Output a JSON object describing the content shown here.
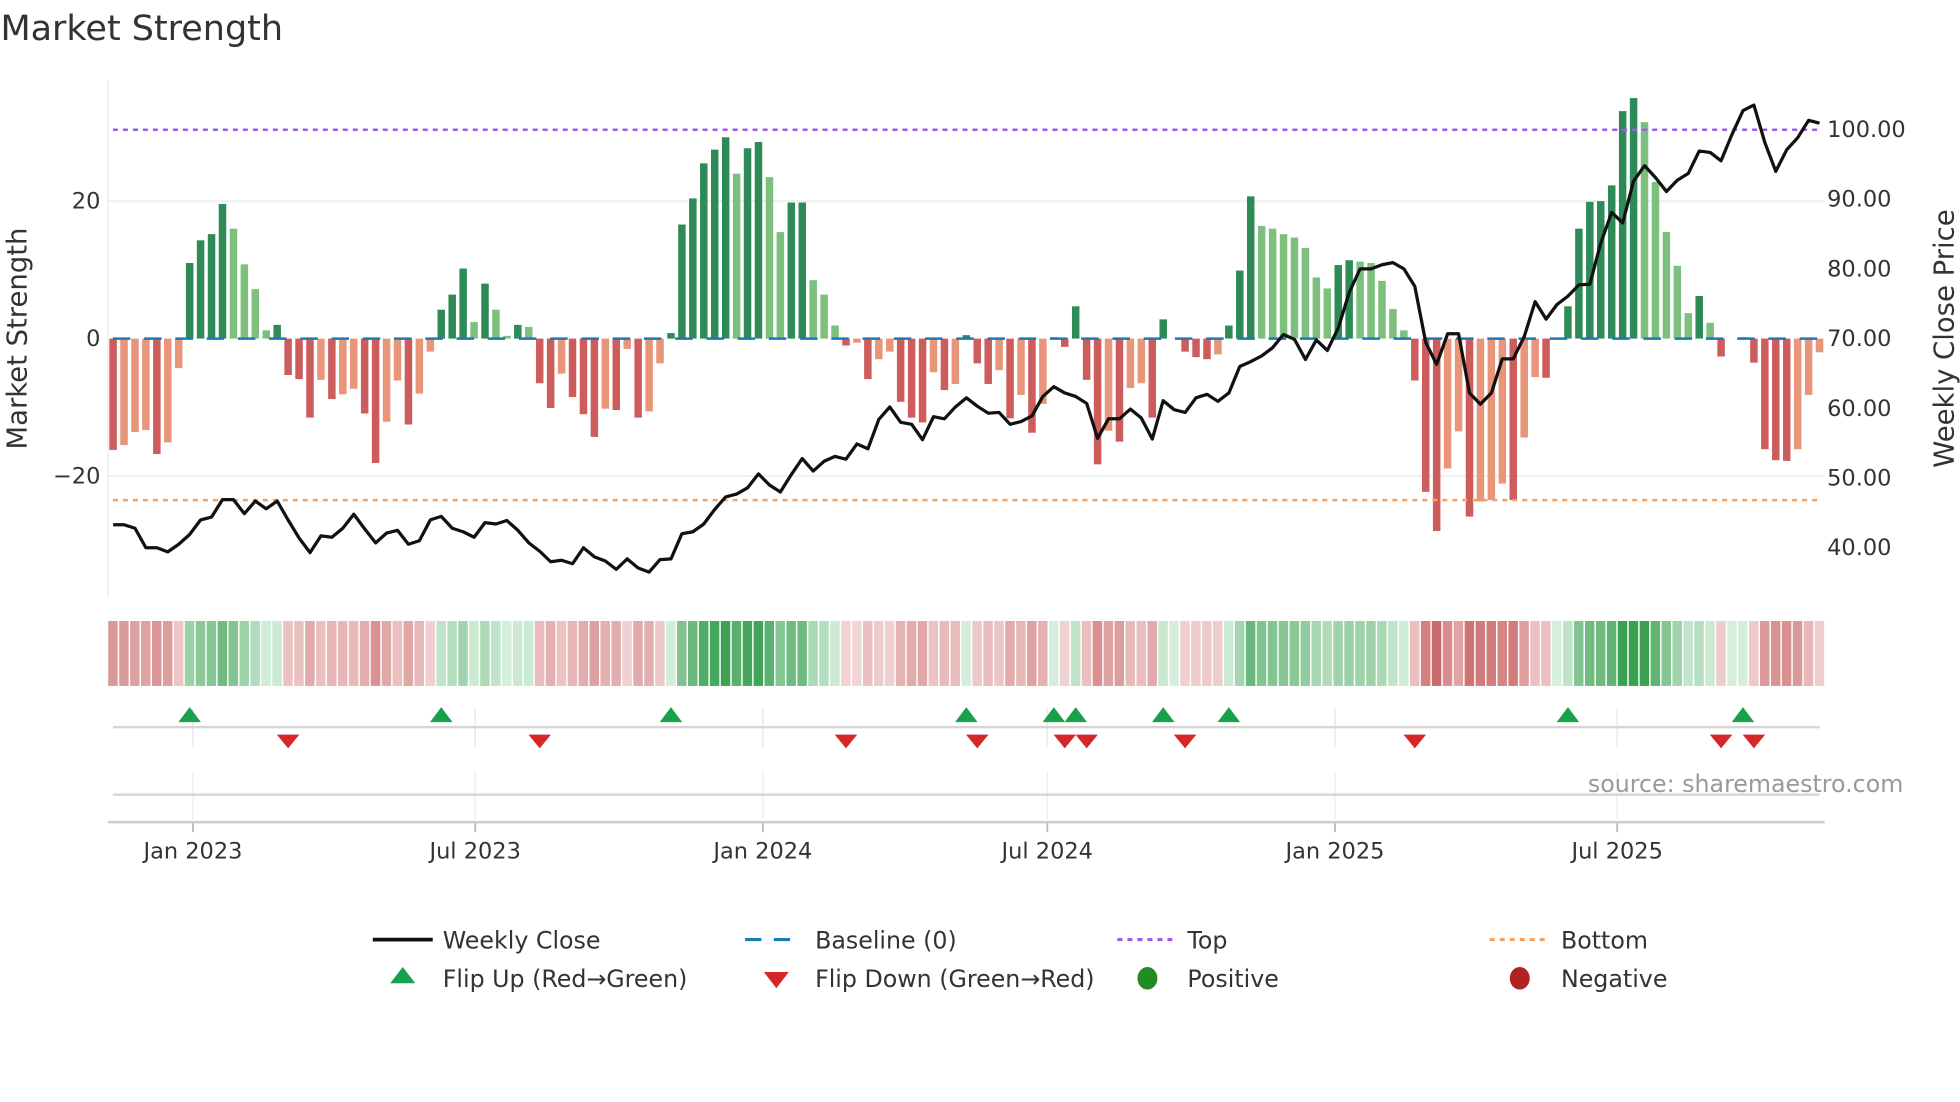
{
  "chart_data": {
    "type": "bar",
    "title": "Market Strength",
    "ylabel": "Market Strength",
    "y2label": "Weekly Close Price",
    "ylim": [
      -36.5,
      38
    ],
    "y2lim": [
      33.5,
      104.5
    ],
    "yticks": [
      {
        "v": 20,
        "label": "20"
      },
      {
        "v": 0,
        "label": "0"
      },
      {
        "v": -20,
        "label": "−20"
      }
    ],
    "y2ticks": [
      {
        "v": 100,
        "label": "100.00"
      },
      {
        "v": 90,
        "label": "90.00"
      },
      {
        "v": 80,
        "label": "80.00"
      },
      {
        "v": 70,
        "label": "70.00"
      },
      {
        "v": 60,
        "label": "60.00"
      },
      {
        "v": 50,
        "label": "50.00"
      },
      {
        "v": 40,
        "label": "40.00"
      }
    ],
    "x_unit": "week index",
    "xticks": [
      {
        "week": 7.3,
        "label": "Jan 2023"
      },
      {
        "week": 33.1,
        "label": "Jul 2023"
      },
      {
        "week": 59.4,
        "label": "Jan 2024"
      },
      {
        "week": 85.4,
        "label": "Jul 2024"
      },
      {
        "week": 111.7,
        "label": "Jan 2025"
      },
      {
        "week": 137.5,
        "label": "Jul 2025"
      }
    ],
    "top_level": 30.4,
    "bottom_level": -23.5,
    "baseline": 0,
    "strength": [
      -16.2,
      -15.5,
      -13.6,
      -13.3,
      -16.8,
      -15.1,
      -4.3,
      11,
      14.3,
      15.2,
      19.6,
      16,
      10.8,
      7.2,
      1.2,
      2,
      -5.3,
      -5.9,
      -11.5,
      -6,
      -8.8,
      -8.1,
      -7.3,
      -10.9,
      -18.1,
      -12.1,
      -6.1,
      -12.5,
      -8,
      -1.9,
      4.2,
      6.4,
      10.2,
      2.4,
      8,
      4.2,
      0.4,
      2,
      1.7,
      -6.5,
      -10.1,
      -5.1,
      -8.5,
      -11,
      -14.3,
      -10.2,
      -10.4,
      -1.5,
      -11.5,
      -10.6,
      -3.6,
      0.8,
      16.6,
      20.4,
      25.5,
      27.5,
      29.3,
      24,
      27.7,
      28.6,
      23.5,
      15.5,
      19.8,
      19.8,
      8.5,
      6.4,
      1.9,
      -1,
      -0.6,
      -5.9,
      -3,
      -1.9,
      -9.2,
      -11.5,
      -12.2,
      -4.9,
      -7.5,
      -6.6,
      0.5,
      -3.6,
      -6.6,
      -4.6,
      -11.6,
      -8.2,
      -13.7,
      -9.5,
      0.2,
      -1.2,
      4.7,
      -6,
      -18.3,
      -13.4,
      -15,
      -7.2,
      -6.5,
      -11.5,
      2.8,
      0,
      -1.9,
      -2.7,
      -3,
      -2.3,
      1.9,
      9.9,
      20.7,
      16.4,
      16,
      15.2,
      14.7,
      13.2,
      8.9,
      7.3,
      10.7,
      11.4,
      11.2,
      11,
      8.4,
      4.3,
      1.2,
      -6.1,
      -22.3,
      -28,
      -18.9,
      -13.5,
      -25.9,
      -23.7,
      -23.5,
      -21.1,
      -23.5,
      -14.4,
      -5.6,
      -5.7,
      0,
      4.7,
      16,
      19.9,
      20,
      22.3,
      33.1,
      35,
      31.5,
      22.8,
      15.5,
      10.6,
      3.7,
      6.2,
      2.3,
      -2.6,
      0,
      0.2,
      -3.5,
      -16.1,
      -17.7,
      -17.8,
      -16.1,
      -8.2,
      -2
    ],
    "strong": [
      1,
      0,
      0,
      0,
      1,
      0,
      0,
      1,
      1,
      1,
      1,
      0,
      0,
      0,
      0,
      1,
      1,
      1,
      1,
      0,
      1,
      0,
      0,
      1,
      1,
      0,
      0,
      1,
      0,
      0,
      1,
      1,
      1,
      0,
      1,
      0,
      0,
      1,
      0,
      1,
      1,
      0,
      1,
      1,
      1,
      0,
      1,
      0,
      1,
      0,
      0,
      1,
      1,
      1,
      1,
      1,
      1,
      0,
      1,
      1,
      0,
      0,
      1,
      1,
      0,
      0,
      0,
      1,
      0,
      1,
      0,
      0,
      1,
      1,
      1,
      0,
      1,
      0,
      1,
      1,
      1,
      0,
      1,
      0,
      1,
      0,
      1,
      1,
      1,
      1,
      1,
      0,
      1,
      0,
      0,
      1,
      1,
      0,
      1,
      1,
      1,
      0,
      1,
      1,
      1,
      0,
      0,
      0,
      0,
      0,
      0,
      0,
      1,
      1,
      0,
      0,
      0,
      0,
      0,
      1,
      1,
      1,
      0,
      0,
      1,
      0,
      0,
      0,
      1,
      0,
      0,
      1,
      0,
      1,
      1,
      1,
      1,
      1,
      1,
      1,
      0,
      0,
      0,
      0,
      0,
      1,
      0,
      1,
      0,
      1,
      1,
      1,
      1,
      1,
      0,
      0,
      0
    ],
    "weekly_close": [
      43.3,
      43.3,
      42.8,
      40,
      40,
      39.4,
      40.5,
      41.9,
      44,
      44.4,
      46.9,
      46.9,
      44.9,
      46.7,
      45.6,
      46.7,
      44,
      41.4,
      39.3,
      41.7,
      41.5,
      42.8,
      44.8,
      42.7,
      40.7,
      42.1,
      42.5,
      40.5,
      41,
      44,
      44.5,
      42.8,
      42.3,
      41.5,
      43.6,
      43.4,
      43.9,
      42.5,
      40.7,
      39.5,
      38,
      38.2,
      37.7,
      40,
      38.7,
      38.1,
      36.9,
      38.4,
      37.1,
      36.5,
      38.3,
      38.4,
      42,
      42.3,
      43.4,
      45.5,
      47.3,
      47.7,
      48.6,
      50.6,
      49,
      48,
      50.5,
      52.8,
      51,
      52.4,
      53.1,
      52.7,
      54.9,
      54.2,
      58.4,
      60.2,
      58,
      57.7,
      55.5,
      58.8,
      58.5,
      60.2,
      61.5,
      60.3,
      59.3,
      59.4,
      57.7,
      58.1,
      58.9,
      61.7,
      63.1,
      62.2,
      61.7,
      60.7,
      55.7,
      58.5,
      58.5,
      59.9,
      58.6,
      55.6,
      61.1,
      59.8,
      59.4,
      61.5,
      62,
      61,
      62.2,
      66,
      66.7,
      67.5,
      68.7,
      70.6,
      69.9,
      67,
      69.8,
      68.3,
      71.5,
      76.6,
      80,
      80,
      80.6,
      80.9,
      80,
      77.5,
      69.4,
      66.3,
      70.7,
      70.7,
      62.2,
      60.6,
      62.2,
      67.1,
      67.1,
      70.3,
      75.3,
      72.8,
      74.9,
      76.1,
      77.7,
      77.8,
      83.7,
      88.1,
      86.6,
      92.6,
      94.8,
      93.1,
      91.1,
      92.7,
      93.7,
      96.9,
      96.7,
      95.5,
      99.3,
      102.7,
      103.5,
      98.1,
      94,
      97.1,
      98.8,
      101.3,
      100.9
    ],
    "flip_up_weeks": [
      7,
      30,
      51,
      78,
      86,
      88,
      96,
      102,
      133,
      149
    ],
    "flip_down_weeks": [
      16,
      39,
      67,
      79,
      87,
      89,
      98,
      119,
      147,
      150
    ],
    "legend": [
      {
        "key": "close",
        "label": "Weekly Close"
      },
      {
        "key": "baseline",
        "label": "Baseline (0)"
      },
      {
        "key": "top",
        "label": "Top"
      },
      {
        "key": "bottom",
        "label": "Bottom"
      },
      {
        "key": "flip_up",
        "label": "Flip Up (Red→Green)"
      },
      {
        "key": "flip_down",
        "label": "Flip Down (Green→Red)"
      },
      {
        "key": "positive",
        "label": "Positive"
      },
      {
        "key": "negative",
        "label": "Negative"
      }
    ],
    "legend_position": "bottom",
    "source": "source: sharemaestro.com",
    "colors": {
      "strong_pos": "#2e8b57",
      "weak_pos": "#7dbf7d",
      "strong_neg": "#cd5c5c",
      "weak_neg": "#e8957a",
      "close": "#111111",
      "baseline": "#1f77b4",
      "top": "#9b5de5",
      "bottom": "#f4a261",
      "flip_up": "#18a04a",
      "flip_down": "#d62728",
      "positive": "#228b22",
      "negative": "#b22222"
    }
  }
}
